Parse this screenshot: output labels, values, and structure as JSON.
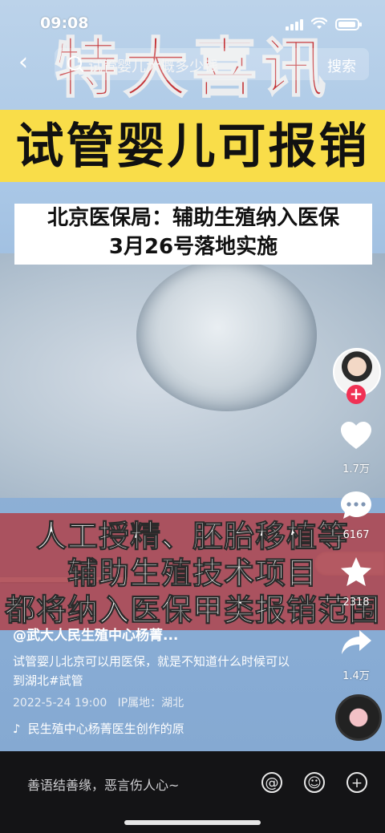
{
  "status_bar": {
    "time": "09:08"
  },
  "search": {
    "placeholder": "试管婴儿大概多少钱",
    "button": "搜索"
  },
  "overlay": {
    "headline": "特大喜讯",
    "banner": "试管婴儿可报销",
    "white_box": [
      "北京医保局：辅助生殖纳入医保",
      "3月26号落地实施"
    ],
    "red_band": [
      "人工授精、胚胎移植等",
      "辅助生殖技术项目",
      "都将纳入医保甲类报销范围"
    ]
  },
  "rail": {
    "likes": "1.7万",
    "comments": "6167",
    "favorites": "2318",
    "shares": "1.4万"
  },
  "post": {
    "author": "@武大人民生殖中心杨菁...",
    "description": "试管婴儿北京可以用医保，就是不知道什么时候可以到湖北#試管",
    "date": "2022-5-24 19:00",
    "location": "IP属地：湖北",
    "music": "民生殖中心杨菁医生创作的原"
  },
  "bottom": {
    "comment_placeholder": "善语结善缘，恶言伤人心~"
  }
}
